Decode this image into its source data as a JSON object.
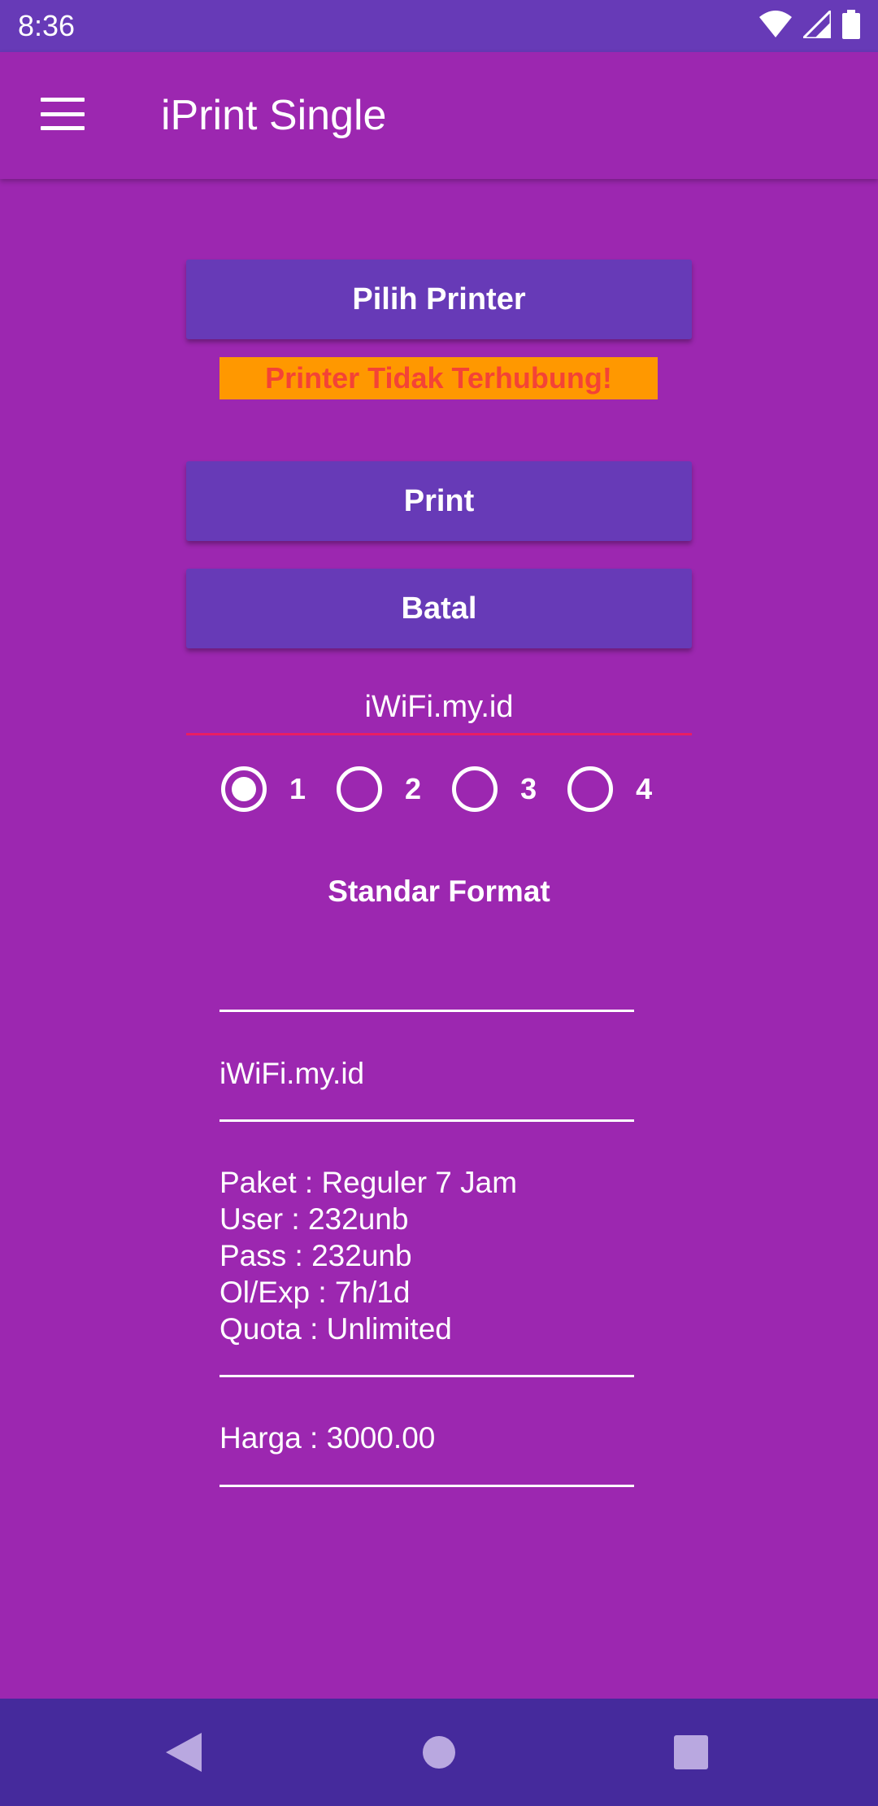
{
  "status_bar": {
    "time": "8:36",
    "icons": [
      "wifi-icon",
      "signal-icon",
      "battery-icon"
    ]
  },
  "app_bar": {
    "title": "iPrint Single",
    "menu_icon": "menu-icon"
  },
  "buttons": {
    "pick_printer": "Pilih Printer",
    "print": "Print",
    "cancel": "Batal"
  },
  "printer_status": "Printer Tidak Terhubung!",
  "ssid_field": {
    "value": "iWiFi.my.id"
  },
  "copies": {
    "options": [
      "1",
      "2",
      "3",
      "4"
    ],
    "selected": "1"
  },
  "format_title": "Standar Format",
  "receipt": {
    "header": "iWiFi.my.id",
    "lines": [
      "Paket : Reguler 7 Jam",
      "User : 232unb",
      "Pass : 232unb",
      "Ol/Exp : 7h/1d",
      "Quota : Unlimited"
    ],
    "price": "Harga : 3000.00"
  },
  "colors": {
    "background": "#9c27b0",
    "status_bar": "#673ab7",
    "button": "#673ab7",
    "warning_bg": "#ff9800",
    "warning_text": "#f44336",
    "input_underline": "#e91e63",
    "nav_bar": "#452a9c"
  },
  "nav_bar": {
    "icons": [
      "back-icon",
      "home-icon",
      "recents-icon"
    ]
  }
}
